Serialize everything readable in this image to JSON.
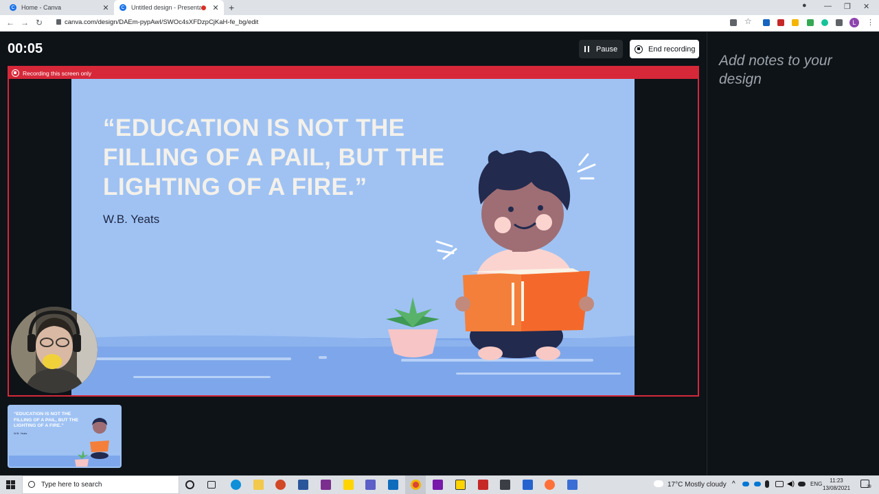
{
  "browser": {
    "tabs": [
      {
        "title": "Home - Canva",
        "close": "✕"
      },
      {
        "title": "Untitled design - Presentatio",
        "close": "✕"
      }
    ],
    "new_tab": "+",
    "url": "canva.com/design/DAEm-pypAwI/SWOc4sXFDzpCjKaH-fe_bg/edit",
    "avatar_letter": "L"
  },
  "recording": {
    "timer": "00:05",
    "pause_label": "Pause",
    "end_label": "End recording",
    "banner": "Recording this screen only"
  },
  "slide": {
    "quote": "“EDUCATION IS NOT THE FILLING OF A PAIL, BUT THE LIGHTING OF A FIRE.”",
    "author": "W.B. Yeats"
  },
  "thumbnail": {
    "quote": "“EDUCATION IS NOT THE FILLING OF A PAIL, BUT THE LIGHTING OF A FIRE.”",
    "author": "W.B. Yeats"
  },
  "notes": {
    "placeholder": "Add notes to your design"
  },
  "taskbar": {
    "search_placeholder": "Type here to search",
    "weather": "17°C  Mostly cloudy",
    "language": "ENG",
    "time": "11:23",
    "date": "13/08/2021",
    "notification_count": "29"
  },
  "colors": {
    "slide_bg": "#9fc2f3",
    "record_red": "#d62839",
    "quote_text": "#f4f1ea",
    "author_text": "#1e2642"
  }
}
